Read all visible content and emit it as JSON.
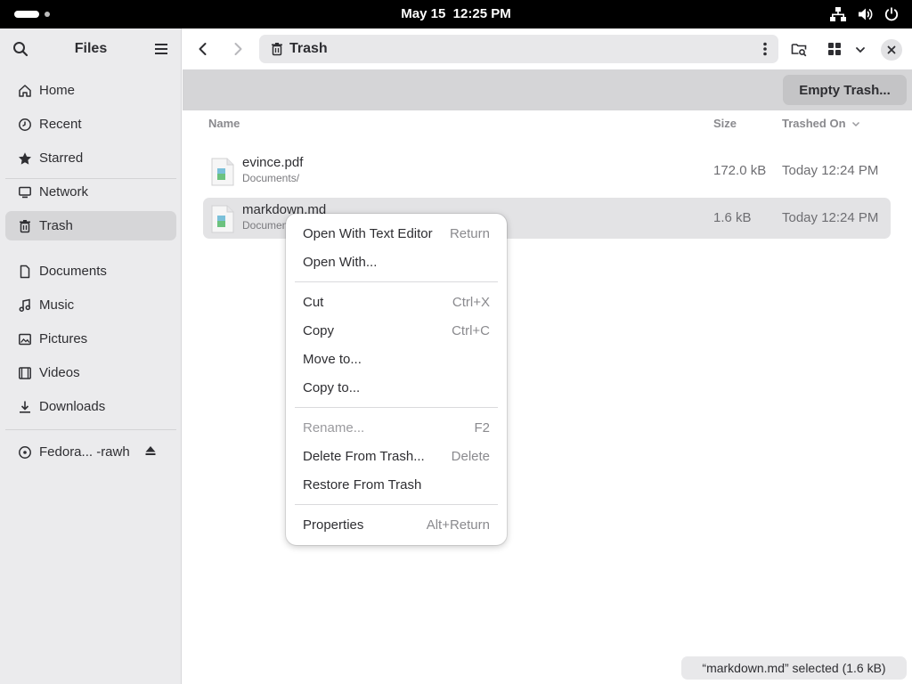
{
  "topbar": {
    "date": "May 15",
    "time": "12:25 PM",
    "icons": [
      "network-wired-icon",
      "volume-icon",
      "power-icon"
    ]
  },
  "sidebar": {
    "title": "Files",
    "places": [
      {
        "label": "Home",
        "icon": "home-icon"
      },
      {
        "label": "Recent",
        "icon": "clock-icon"
      },
      {
        "label": "Starred",
        "icon": "star-icon"
      },
      {
        "label": "Network",
        "icon": "monitor-icon"
      },
      {
        "label": "Trash",
        "icon": "trash-icon",
        "active": true
      }
    ],
    "bookmarks": [
      {
        "label": "Documents",
        "icon": "document-icon"
      },
      {
        "label": "Music",
        "icon": "music-icon"
      },
      {
        "label": "Pictures",
        "icon": "picture-icon"
      },
      {
        "label": "Videos",
        "icon": "video-icon"
      },
      {
        "label": "Downloads",
        "icon": "download-icon"
      }
    ],
    "devices": [
      {
        "label": "Fedora... -rawh",
        "icon": "disc-icon"
      }
    ]
  },
  "header": {
    "location": "Trash"
  },
  "actionbar": {
    "empty_label": "Empty Trash..."
  },
  "columns": {
    "name": "Name",
    "size": "Size",
    "trashed": "Trashed On"
  },
  "files": [
    {
      "name": "evince.pdf",
      "path": "Documents/",
      "size": "172.0 kB",
      "trashed": "Today 12:24 PM",
      "selected": false
    },
    {
      "name": "markdown.md",
      "path": "Documents/",
      "size": "1.6 kB",
      "trashed": "Today 12:24 PM",
      "selected": true
    }
  ],
  "context_menu": {
    "items": [
      {
        "label": "Open With Text Editor",
        "accel": "Return"
      },
      {
        "label": "Open With...",
        "accel": ""
      },
      {
        "label": "Cut",
        "accel": "Ctrl+X"
      },
      {
        "label": "Copy",
        "accel": "Ctrl+C"
      },
      {
        "label": "Move to...",
        "accel": ""
      },
      {
        "label": "Copy to...",
        "accel": ""
      },
      {
        "label": "Rename...",
        "accel": "F2",
        "disabled": true
      },
      {
        "label": "Delete From Trash...",
        "accel": "Delete"
      },
      {
        "label": "Restore From Trash",
        "accel": ""
      },
      {
        "label": "Properties",
        "accel": "Alt+Return"
      }
    ]
  },
  "status": {
    "text": "“markdown.md” selected  (1.6 kB)"
  }
}
